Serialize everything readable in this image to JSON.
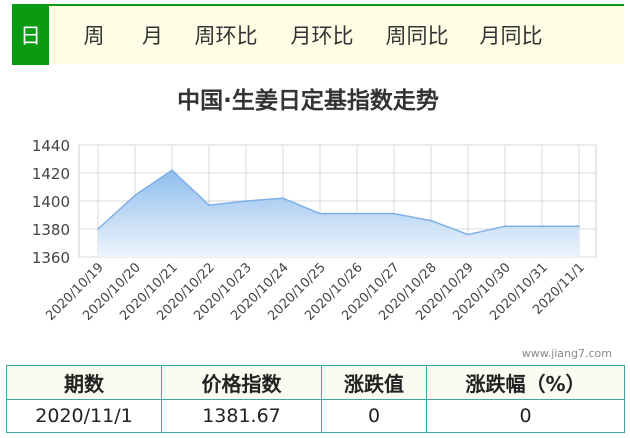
{
  "tabs": [
    {
      "label": "日",
      "active": true
    },
    {
      "label": "周",
      "active": false
    },
    {
      "label": "月",
      "active": false
    },
    {
      "label": "周环比",
      "active": false
    },
    {
      "label": "月环比",
      "active": false
    },
    {
      "label": "周同比",
      "active": false
    },
    {
      "label": "月同比",
      "active": false
    }
  ],
  "chart_data": {
    "type": "area",
    "title": "中国·生姜日定基指数走势",
    "categories": [
      "2020/10/19",
      "2020/10/20",
      "2020/10/21",
      "2020/10/22",
      "2020/10/23",
      "2020/10/24",
      "2020/10/25",
      "2020/10/26",
      "2020/10/27",
      "2020/10/28",
      "2020/10/29",
      "2020/10/30",
      "2020/10/31",
      "2020/11/1"
    ],
    "series": [
      {
        "values": [
          1380,
          1404,
          1422,
          1397,
          1400,
          1402,
          1391,
          1391,
          1391,
          1386,
          1376,
          1382,
          1382,
          1382
        ]
      }
    ],
    "ylim": [
      1360,
      1440
    ],
    "yticks": [
      1360,
      1380,
      1400,
      1420,
      1440
    ],
    "grid": true,
    "line_color": "#7fb0e6",
    "fill_top_color": "#8fbdee",
    "fill_bottom_color": "#eef5fd",
    "watermark": "www.jiang7.com"
  },
  "table": {
    "headers": [
      "期数",
      "价格指数",
      "涨跌值",
      "涨跌幅（%）"
    ],
    "rows": [
      [
        "2020/11/1",
        "1381.67",
        "0",
        "0"
      ]
    ]
  },
  "colors": {
    "accent": "#0b9b12",
    "tab_bg": "#fefee6",
    "table_border": "#3aa7a5"
  }
}
